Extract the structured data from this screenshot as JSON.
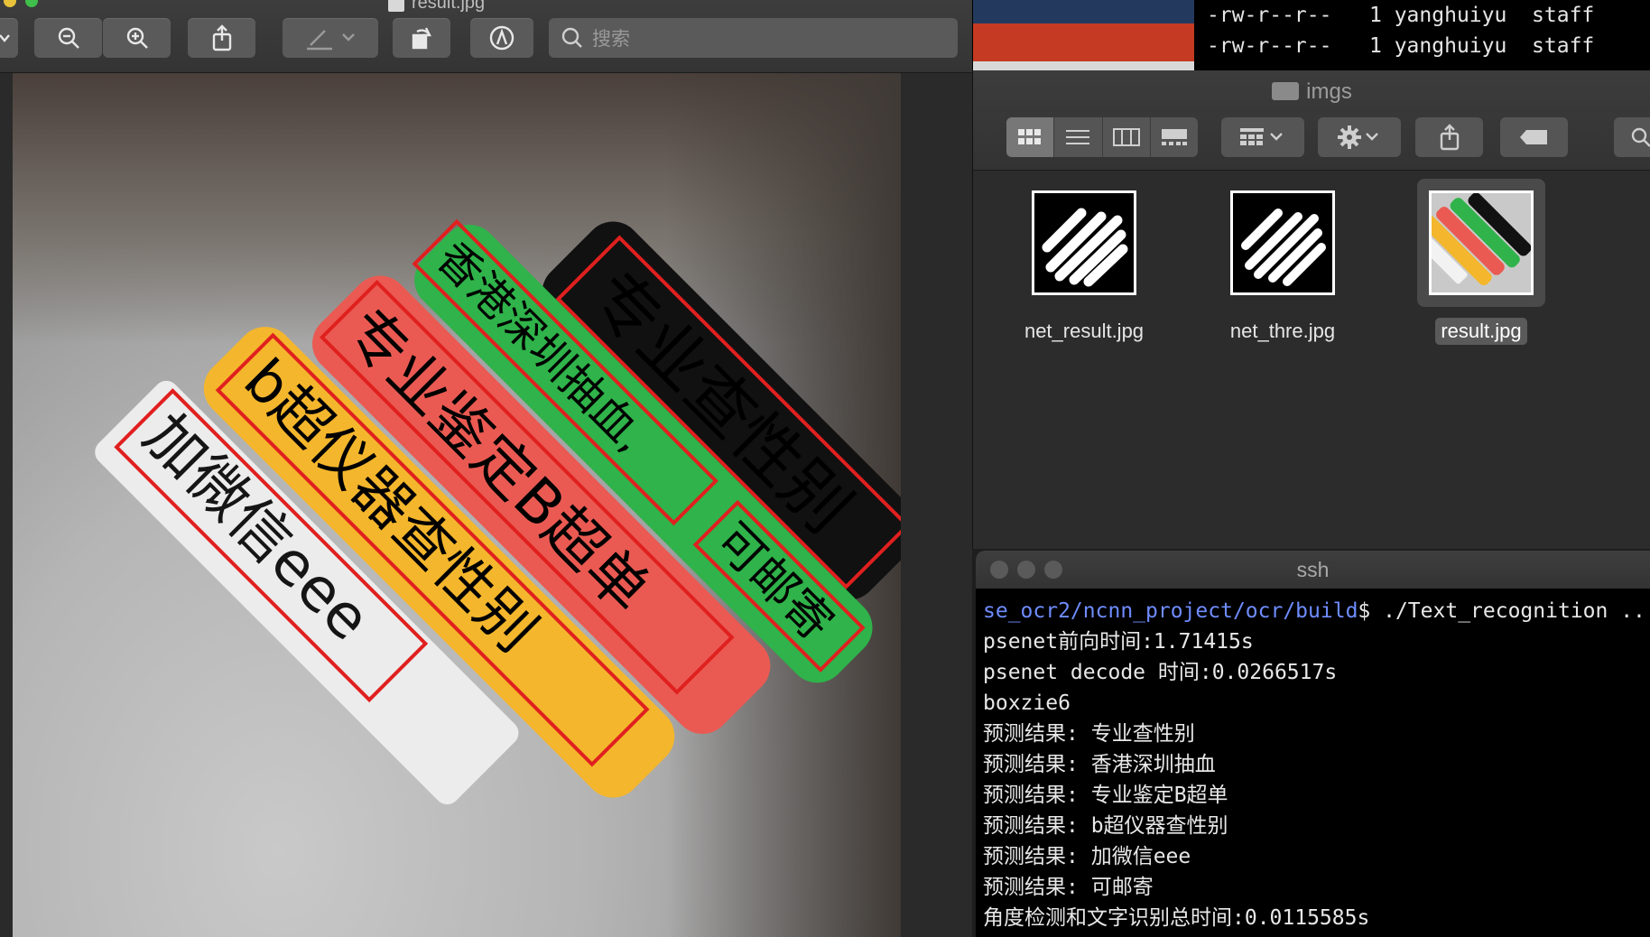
{
  "preview": {
    "title": "result.jpg",
    "search_placeholder": "搜索",
    "photo": {
      "labels": [
        {
          "text": "专业查性别",
          "color": "#111111",
          "text_color": "#ffffff"
        },
        {
          "text": "可邮寄",
          "color": "#2fb34a",
          "text_color": "#ffffff"
        },
        {
          "text": "香港深圳抽血,",
          "color": "#2fb34a",
          "text_color": "#ffffff"
        },
        {
          "text": "专业鉴定B超单",
          "color": "#ea5a52",
          "text_color": "#ffffff"
        },
        {
          "text": "b超仪器查性别",
          "color": "#f4b62c",
          "text_color": "#ffffff"
        },
        {
          "text": "加微信eee",
          "color": "#ececec",
          "text_color": "#151515"
        }
      ]
    }
  },
  "top_terminal": {
    "lines": [
      "-rw-r--r--   1 yanghuiyu  staff",
      "-rw-r--r--   1 yanghuiyu  staff"
    ]
  },
  "finder": {
    "folder": "imgs",
    "files": [
      {
        "name": "net_result.jpg",
        "selected": false
      },
      {
        "name": "net_thre.jpg",
        "selected": false
      },
      {
        "name": "result.jpg",
        "selected": true
      }
    ]
  },
  "ssh": {
    "title": "ssh",
    "prompt_path": "se_ocr2/ncnn_project/ocr/build",
    "prompt_cmd": "$ ./Text_recognition ..",
    "output": [
      "psenet前向时间:1.71415s",
      "psenet decode 时间:0.0266517s",
      "boxzie6",
      "预测结果: 专业查性别",
      "预测结果: 香港深圳抽血",
      "预测结果: 专业鉴定B超单",
      "预测结果: b超仪器查性别",
      "预测结果: 加微信eee",
      "预测结果: 可邮寄",
      "角度检测和文字识别总时间:0.0115585s"
    ]
  },
  "colors": {
    "box_red": "#e0201f",
    "path_blue": "#6f8cff"
  }
}
